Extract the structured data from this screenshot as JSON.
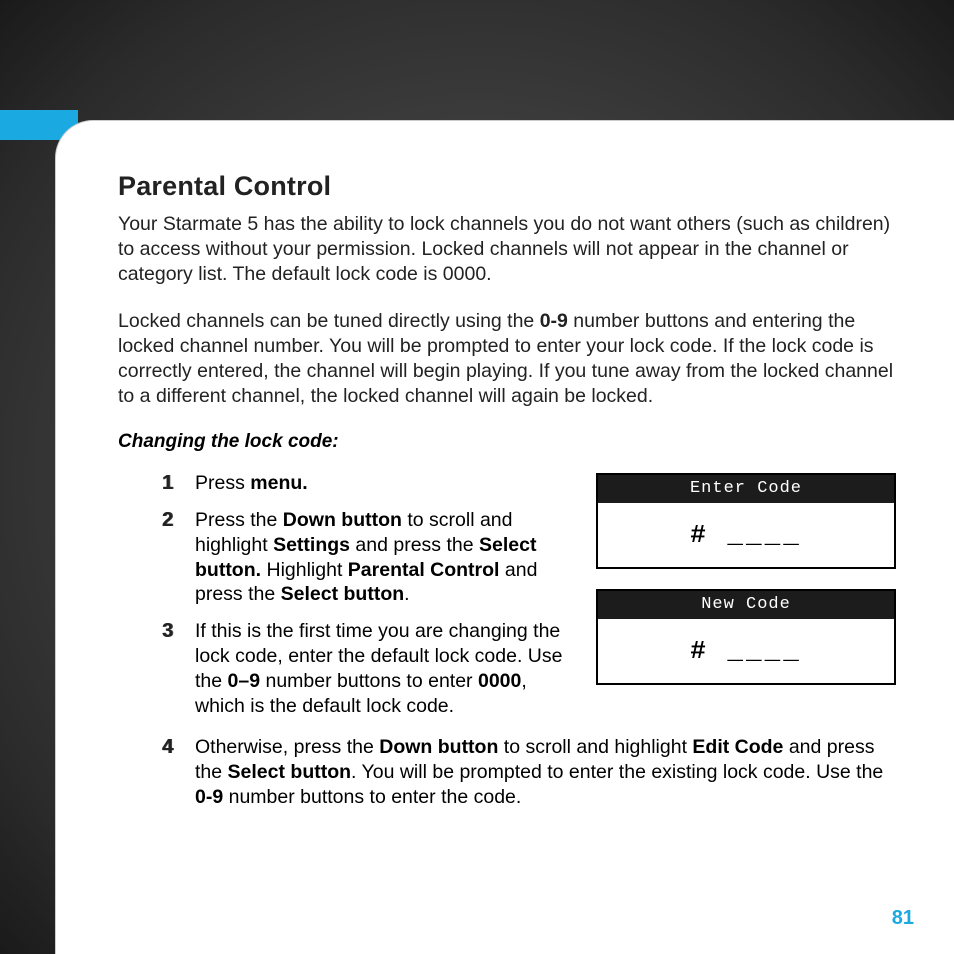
{
  "title": "Parental Control",
  "para1": "Your Starmate 5 has the ability to lock channels you do not want others (such as children) to access without your permission. Locked channels will not appear in the channel or category list. The default lock code is 0000.",
  "para2_pre": "Locked channels can be tuned directly using the ",
  "para2_bold1": "0-9",
  "para2_post": " number buttons and entering the locked channel number. You will be prompted to enter your lock code. If the lock code is correctly entered, the channel will begin playing. If you tune away from the locked channel to a different channel, the locked channel will again be locked.",
  "subhead": "Changing the lock code:",
  "steps": [
    {
      "n": "1",
      "pre": "Press ",
      "b1": "menu."
    },
    {
      "n": "2",
      "pre": "Press the ",
      "b1": "Down button",
      "mid1": " to scroll and highlight ",
      "b2": "Settings",
      "mid2": " and press the ",
      "b3": "Select button.",
      "mid3": " Highlight ",
      "b4": "Parental Control",
      "mid4": " and press the ",
      "b5": "Select button",
      "post": "."
    },
    {
      "n": "3",
      "pre": "If this is the first time you are changing the lock code, enter the default lock code. Use the ",
      "b1": "0–9",
      "mid1": " number buttons to enter ",
      "b2": "0000",
      "post": ", which is the default lock code."
    },
    {
      "n": "4",
      "pre": "Otherwise, press the ",
      "b1": "Down button",
      "mid1": " to scroll and highlight ",
      "b2": "Edit Code",
      "mid2": " and press the ",
      "b3": "Select button",
      "mid3": ". You will be prompted to enter the existing lock code. Use the ",
      "b4": "0-9",
      "post": " number buttons to enter the code."
    }
  ],
  "screens": [
    {
      "title": "Enter Code",
      "body": "# ____"
    },
    {
      "title": "New Code",
      "body": "# ____"
    }
  ],
  "page_number": "81"
}
